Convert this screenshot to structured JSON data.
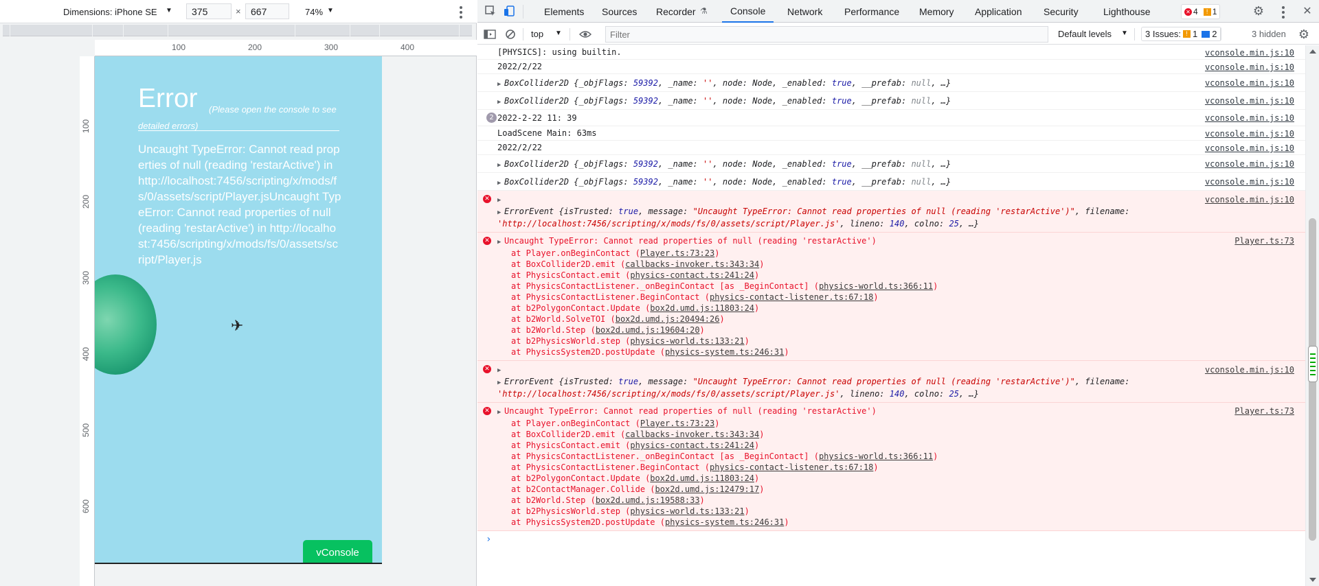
{
  "device_toolbar": {
    "dimensions_label": "Dimensions: iPhone SE",
    "width": "375",
    "height": "667",
    "separator": "×",
    "zoom": "74%"
  },
  "rulers": {
    "top": [
      "100",
      "200",
      "300",
      "400"
    ],
    "left": [
      "100",
      "200",
      "300",
      "400",
      "500",
      "600"
    ]
  },
  "phone": {
    "error_title": "Error",
    "error_subtitle": "(Please open the console to see detailed errors)",
    "error_message": "Uncaught TypeError: Cannot read properties of null (reading 'restarActive') in http://localhost:7456/scripting/x/mods/fs/0/assets/script/Player.jsUncaught TypeError: Cannot read properties of null (reading 'restarActive') in http://localhost:7456/scripting/x/mods/fs/0/assets/script/Player.js",
    "vconsole_button": "vConsole"
  },
  "devtools_tabs": [
    "Elements",
    "Sources",
    "Recorder",
    "Console",
    "Network",
    "Performance",
    "Memory",
    "Application",
    "Security",
    "Lighthouse"
  ],
  "active_tab": "Console",
  "badges": {
    "errors": "4",
    "warnings": "1"
  },
  "console_toolbar": {
    "context": "top",
    "filter_placeholder": "Filter",
    "levels": "Default levels",
    "issues_label": "3 Issues:",
    "issues_warn": "1",
    "issues_info": "2",
    "hidden": "3 hidden"
  },
  "log": {
    "src_vconsole": "vconsole.min.js:10",
    "src_player": "Player.ts:73",
    "physics": "[PHYSICS]: using builtin.",
    "date1": "2022/2/22",
    "date_count": "2",
    "datetime": "2022-2-22 11: 39",
    "loadscene": "LoadScene Main: 63ms",
    "error_message": "Uncaught TypeError: Cannot read properties of null (reading 'restarActive')",
    "errorevent_filename": "'http://localhost:7456/scripting/x/mods/fs/0/assets/script/Player.js'",
    "trace1": [
      {
        "fn": "at Player.onBeginContact (",
        "loc": "Player.ts:73:23"
      },
      {
        "fn": "at BoxCollider2D.emit (",
        "loc": "callbacks-invoker.ts:343:34"
      },
      {
        "fn": "at PhysicsContact.emit (",
        "loc": "physics-contact.ts:241:24"
      },
      {
        "fn": "at PhysicsContactListener._onBeginContact [as _BeginContact] (",
        "loc": "physics-world.ts:366:11"
      },
      {
        "fn": "at PhysicsContactListener.BeginContact (",
        "loc": "physics-contact-listener.ts:67:18"
      },
      {
        "fn": "at b2PolygonContact.Update (",
        "loc": "box2d.umd.js:11803:24"
      },
      {
        "fn": "at b2World.SolveTOI (",
        "loc": "box2d.umd.js:20494:26"
      },
      {
        "fn": "at b2World.Step (",
        "loc": "box2d.umd.js:19604:20"
      },
      {
        "fn": "at b2PhysicsWorld.step (",
        "loc": "physics-world.ts:133:21"
      },
      {
        "fn": "at PhysicsSystem2D.postUpdate (",
        "loc": "physics-system.ts:246:31"
      }
    ],
    "trace2": [
      {
        "fn": "at Player.onBeginContact (",
        "loc": "Player.ts:73:23"
      },
      {
        "fn": "at BoxCollider2D.emit (",
        "loc": "callbacks-invoker.ts:343:34"
      },
      {
        "fn": "at PhysicsContact.emit (",
        "loc": "physics-contact.ts:241:24"
      },
      {
        "fn": "at PhysicsContactListener._onBeginContact [as _BeginContact] (",
        "loc": "physics-world.ts:366:11"
      },
      {
        "fn": "at PhysicsContactListener.BeginContact (",
        "loc": "physics-contact-listener.ts:67:18"
      },
      {
        "fn": "at b2PolygonContact.Update (",
        "loc": "box2d.umd.js:11803:24"
      },
      {
        "fn": "at b2ContactManager.Collide (",
        "loc": "box2d.umd.js:12479:17"
      },
      {
        "fn": "at b2World.Step (",
        "loc": "box2d.umd.js:19588:33"
      },
      {
        "fn": "at b2PhysicsWorld.step (",
        "loc": "physics-world.ts:133:21"
      },
      {
        "fn": "at PhysicsSystem2D.postUpdate (",
        "loc": "physics-system.ts:246:31"
      }
    ],
    "prompt": "›"
  },
  "icons": {
    "inspect": "inspect-icon",
    "device": "device-toggle-icon",
    "settings": "gear-icon",
    "more": "kebab-icon",
    "sidebar": "sidebar-icon",
    "clear": "clear-icon",
    "eye": "eye-icon"
  },
  "colors": {
    "accent": "#1a73e8",
    "error": "#e8112a",
    "error_bg": "#fff0f0",
    "phone_bg": "#9cdcee",
    "vconsole": "#07c160"
  }
}
